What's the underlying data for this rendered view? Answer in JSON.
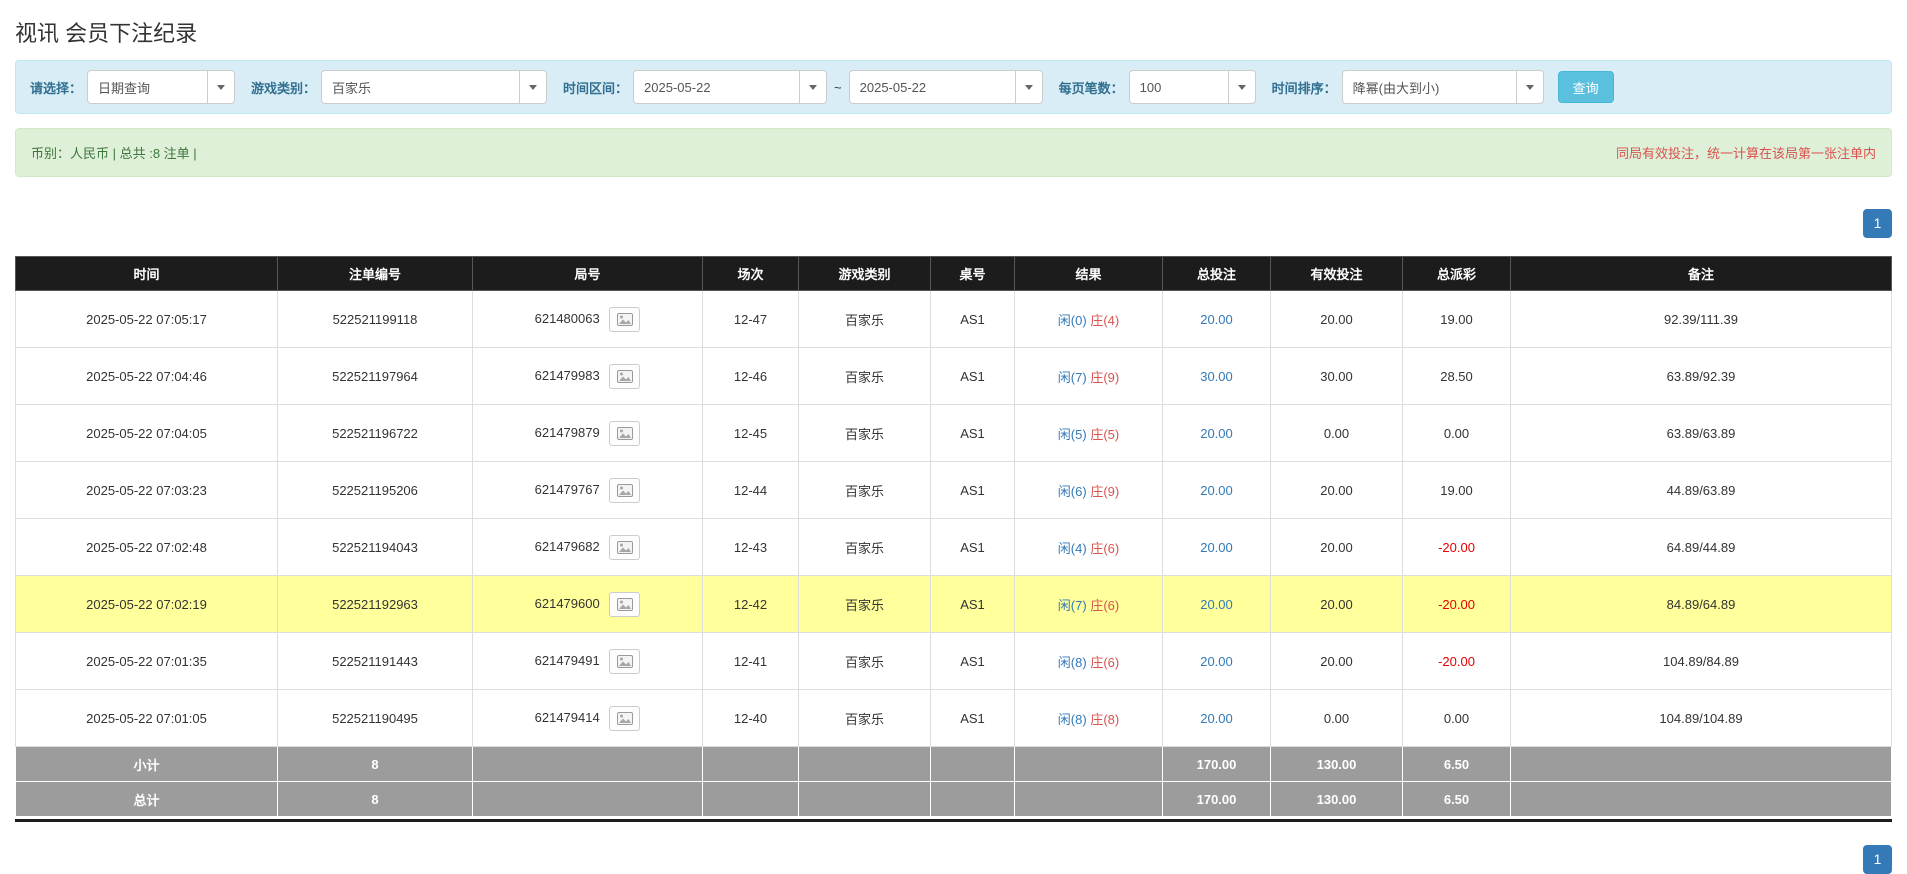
{
  "page": {
    "title": "视讯 会员下注纪录"
  },
  "filter": {
    "select_label": "请选择：",
    "select_value": "日期查询",
    "game_label": "游戏类别：",
    "game_value": "百家乐",
    "range_label": "时间区间：",
    "date_from": "2025-05-22",
    "range_sep": "~",
    "date_to": "2025-05-22",
    "per_page_label": "每页笔数：",
    "per_page_value": "100",
    "sort_label": "时间排序：",
    "sort_value": "降幂(由大到小)",
    "search_button": "查询"
  },
  "summary": {
    "left": "币别：人民币 | 总共 :8 注单 |",
    "right": "同局有效投注，统一计算在该局第一张注单内"
  },
  "pagination": {
    "current": "1"
  },
  "table": {
    "headers": [
      "时间",
      "注单编号",
      "局号",
      "场次",
      "游戏类别",
      "桌号",
      "结果",
      "总投注",
      "有效投注",
      "总派彩",
      "备注"
    ],
    "rows": [
      {
        "time": "2025-05-22 07:05:17",
        "bet_no": "522521199118",
        "round_no": "621480063",
        "session": "12-47",
        "game": "百家乐",
        "table_no": "AS1",
        "result": {
          "player": "闲(0)",
          "banker": "庄(4)"
        },
        "total_bet": "20.00",
        "valid_bet": "20.00",
        "payout": "19.00",
        "note": "92.39/111.39",
        "highlight": false
      },
      {
        "time": "2025-05-22 07:04:46",
        "bet_no": "522521197964",
        "round_no": "621479983",
        "session": "12-46",
        "game": "百家乐",
        "table_no": "AS1",
        "result": {
          "player": "闲(7)",
          "banker": "庄(9)"
        },
        "total_bet": "30.00",
        "valid_bet": "30.00",
        "payout": "28.50",
        "note": "63.89/92.39",
        "highlight": false
      },
      {
        "time": "2025-05-22 07:04:05",
        "bet_no": "522521196722",
        "round_no": "621479879",
        "session": "12-45",
        "game": "百家乐",
        "table_no": "AS1",
        "result": {
          "player": "闲(5)",
          "banker": "庄(5)"
        },
        "total_bet": "20.00",
        "valid_bet": "0.00",
        "payout": "0.00",
        "note": "63.89/63.89",
        "highlight": false
      },
      {
        "time": "2025-05-22 07:03:23",
        "bet_no": "522521195206",
        "round_no": "621479767",
        "session": "12-44",
        "game": "百家乐",
        "table_no": "AS1",
        "result": {
          "player": "闲(6)",
          "banker": "庄(9)"
        },
        "total_bet": "20.00",
        "valid_bet": "20.00",
        "payout": "19.00",
        "note": "44.89/63.89",
        "highlight": false
      },
      {
        "time": "2025-05-22 07:02:48",
        "bet_no": "522521194043",
        "round_no": "621479682",
        "session": "12-43",
        "game": "百家乐",
        "table_no": "AS1",
        "result": {
          "player": "闲(4)",
          "banker": "庄(6)"
        },
        "total_bet": "20.00",
        "valid_bet": "20.00",
        "payout": "-20.00",
        "note": "64.89/44.89",
        "highlight": false
      },
      {
        "time": "2025-05-22 07:02:19",
        "bet_no": "522521192963",
        "round_no": "621479600",
        "session": "12-42",
        "game": "百家乐",
        "table_no": "AS1",
        "result": {
          "player": "闲(7)",
          "banker": "庄(6)"
        },
        "total_bet": "20.00",
        "valid_bet": "20.00",
        "payout": "-20.00",
        "note": "84.89/64.89",
        "highlight": true
      },
      {
        "time": "2025-05-22 07:01:35",
        "bet_no": "522521191443",
        "round_no": "621479491",
        "session": "12-41",
        "game": "百家乐",
        "table_no": "AS1",
        "result": {
          "player": "闲(8)",
          "banker": "庄(6)"
        },
        "total_bet": "20.00",
        "valid_bet": "20.00",
        "payout": "-20.00",
        "note": "104.89/84.89",
        "highlight": false
      },
      {
        "time": "2025-05-22 07:01:05",
        "bet_no": "522521190495",
        "round_no": "621479414",
        "session": "12-40",
        "game": "百家乐",
        "table_no": "AS1",
        "result": {
          "player": "闲(8)",
          "banker": "庄(8)"
        },
        "total_bet": "20.00",
        "valid_bet": "0.00",
        "payout": "0.00",
        "note": "104.89/104.89",
        "highlight": false
      }
    ],
    "subtotal": {
      "label": "小计",
      "count": "8",
      "total_bet": "170.00",
      "valid_bet": "130.00",
      "payout": "6.50"
    },
    "total": {
      "label": "总计",
      "count": "8",
      "total_bet": "170.00",
      "valid_bet": "130.00",
      "payout": "6.50"
    }
  },
  "colors": {
    "accent_blue": "#337ab7",
    "player_blue": "#337ab7",
    "banker_red": "#d9534f",
    "negative_red": "#e60000",
    "highlight_yellow": "#ffff9c",
    "search_button_bg": "#5bc0de",
    "filter_bar_bg": "#d9edf7",
    "summary_bar_bg": "#dff0d8",
    "table_header_bg": "#1c1c1c",
    "footer_row_bg": "#9c9c9c"
  }
}
